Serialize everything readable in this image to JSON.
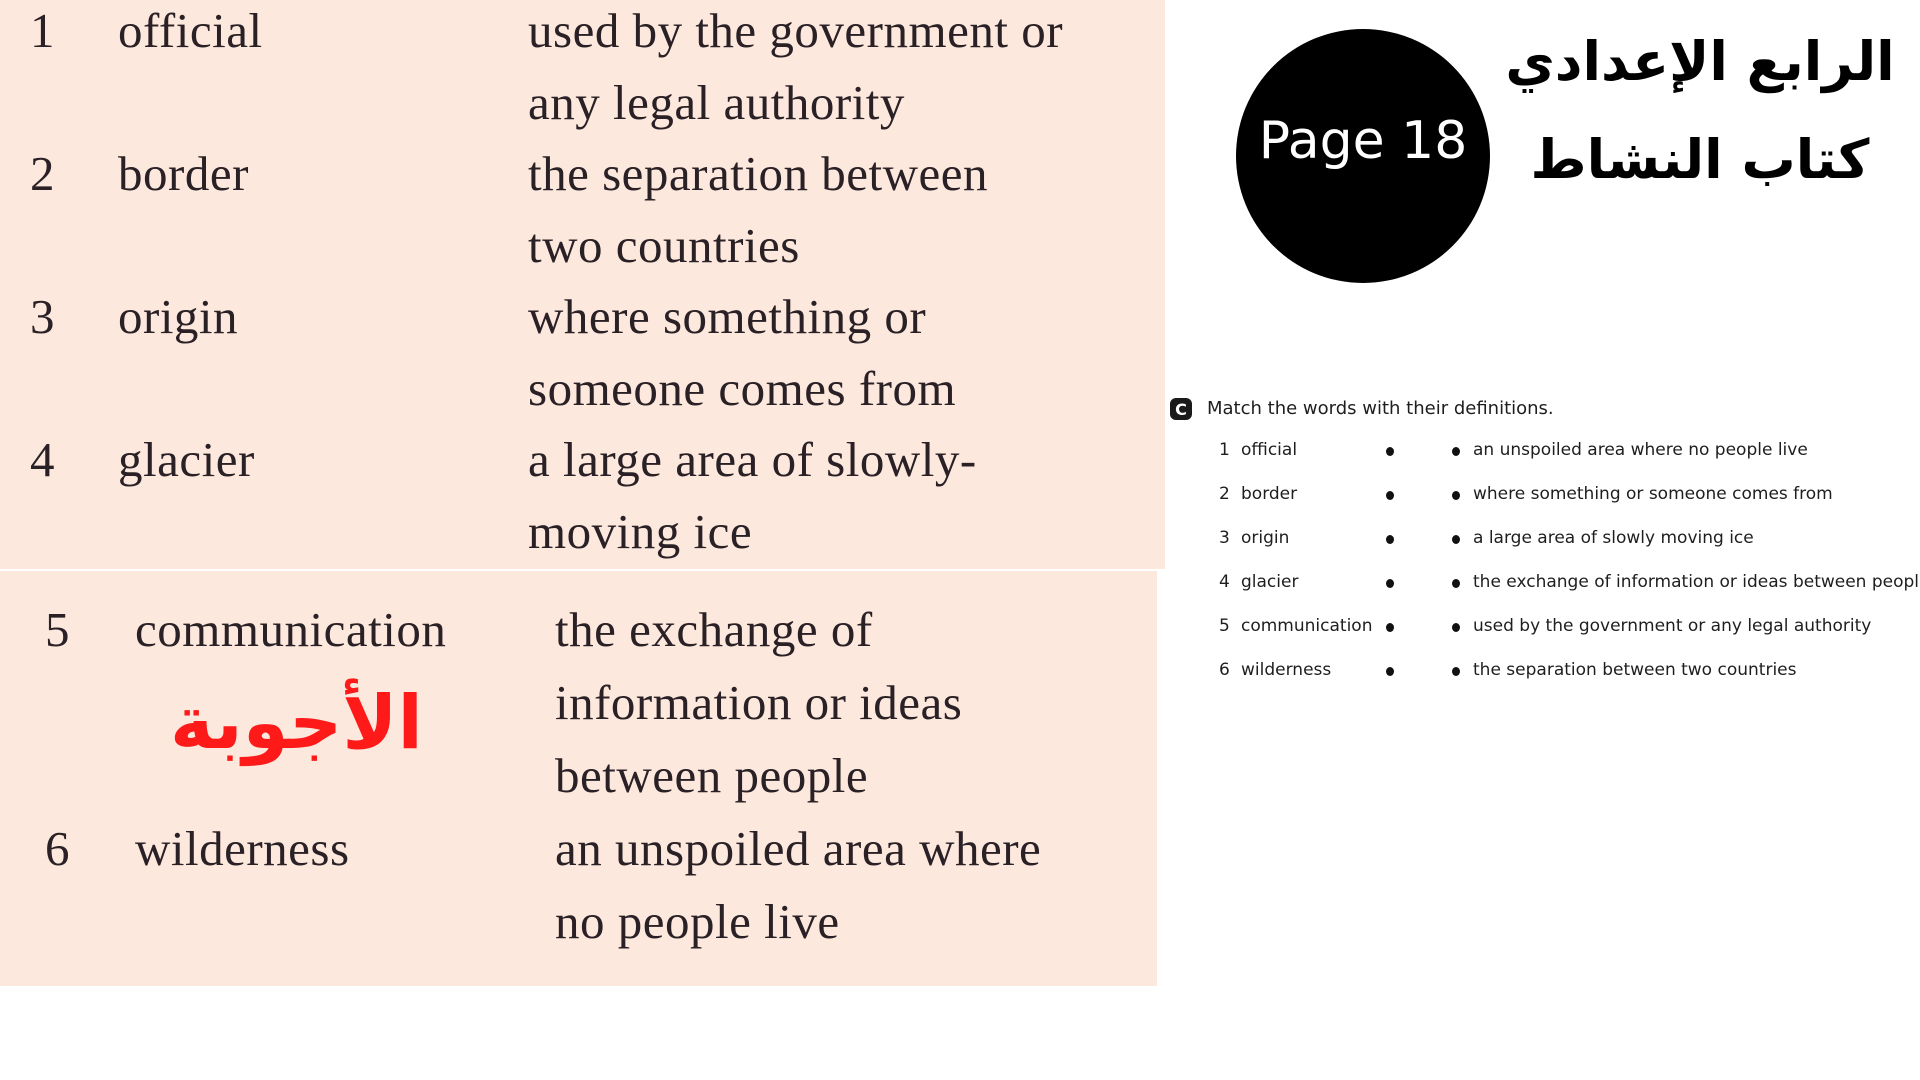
{
  "answers": {
    "label": "الأجوبة",
    "label_color": "#ff1a1a",
    "panel_color": "#fde8dd",
    "top_items": [
      {
        "number": "1",
        "word": "official",
        "definition_lines": [
          "used by the government or",
          "any legal authority"
        ]
      },
      {
        "number": "2",
        "word": "border",
        "definition_lines": [
          "the separation between",
          "two countries"
        ]
      },
      {
        "number": "3",
        "word": "origin",
        "definition_lines": [
          "where something or",
          "someone comes from"
        ]
      },
      {
        "number": "4",
        "word": "glacier",
        "definition_lines": [
          "a large area of slowly-",
          "moving ice"
        ]
      }
    ],
    "bottom_items": [
      {
        "number": "5",
        "word": "communication",
        "definition_lines": [
          "the exchange of",
          "information or ideas",
          "between people"
        ]
      },
      {
        "number": "6",
        "word": "wilderness",
        "definition_lines": [
          "an unspoiled area where",
          "no people live"
        ]
      }
    ]
  },
  "header": {
    "page_label": "Page 18",
    "title_line1": "الرابع الإعدادي",
    "title_line2": "كتاب النشاط"
  },
  "exercise": {
    "badge": "C",
    "instruction": "Match the words with their definitions.",
    "rows": [
      {
        "number": "1",
        "word": "official",
        "definition": "an unspoiled area where no people live"
      },
      {
        "number": "2",
        "word": "border",
        "definition": "where something or someone comes from"
      },
      {
        "number": "3",
        "word": "origin",
        "definition": "a large area of slowly moving ice"
      },
      {
        "number": "4",
        "word": "glacier",
        "definition": "the exchange of information or ideas between people"
      },
      {
        "number": "5",
        "word": "communication",
        "definition": "used by the government or any legal authority"
      },
      {
        "number": "6",
        "word": "wilderness",
        "definition": "the separation between two countries"
      }
    ]
  }
}
